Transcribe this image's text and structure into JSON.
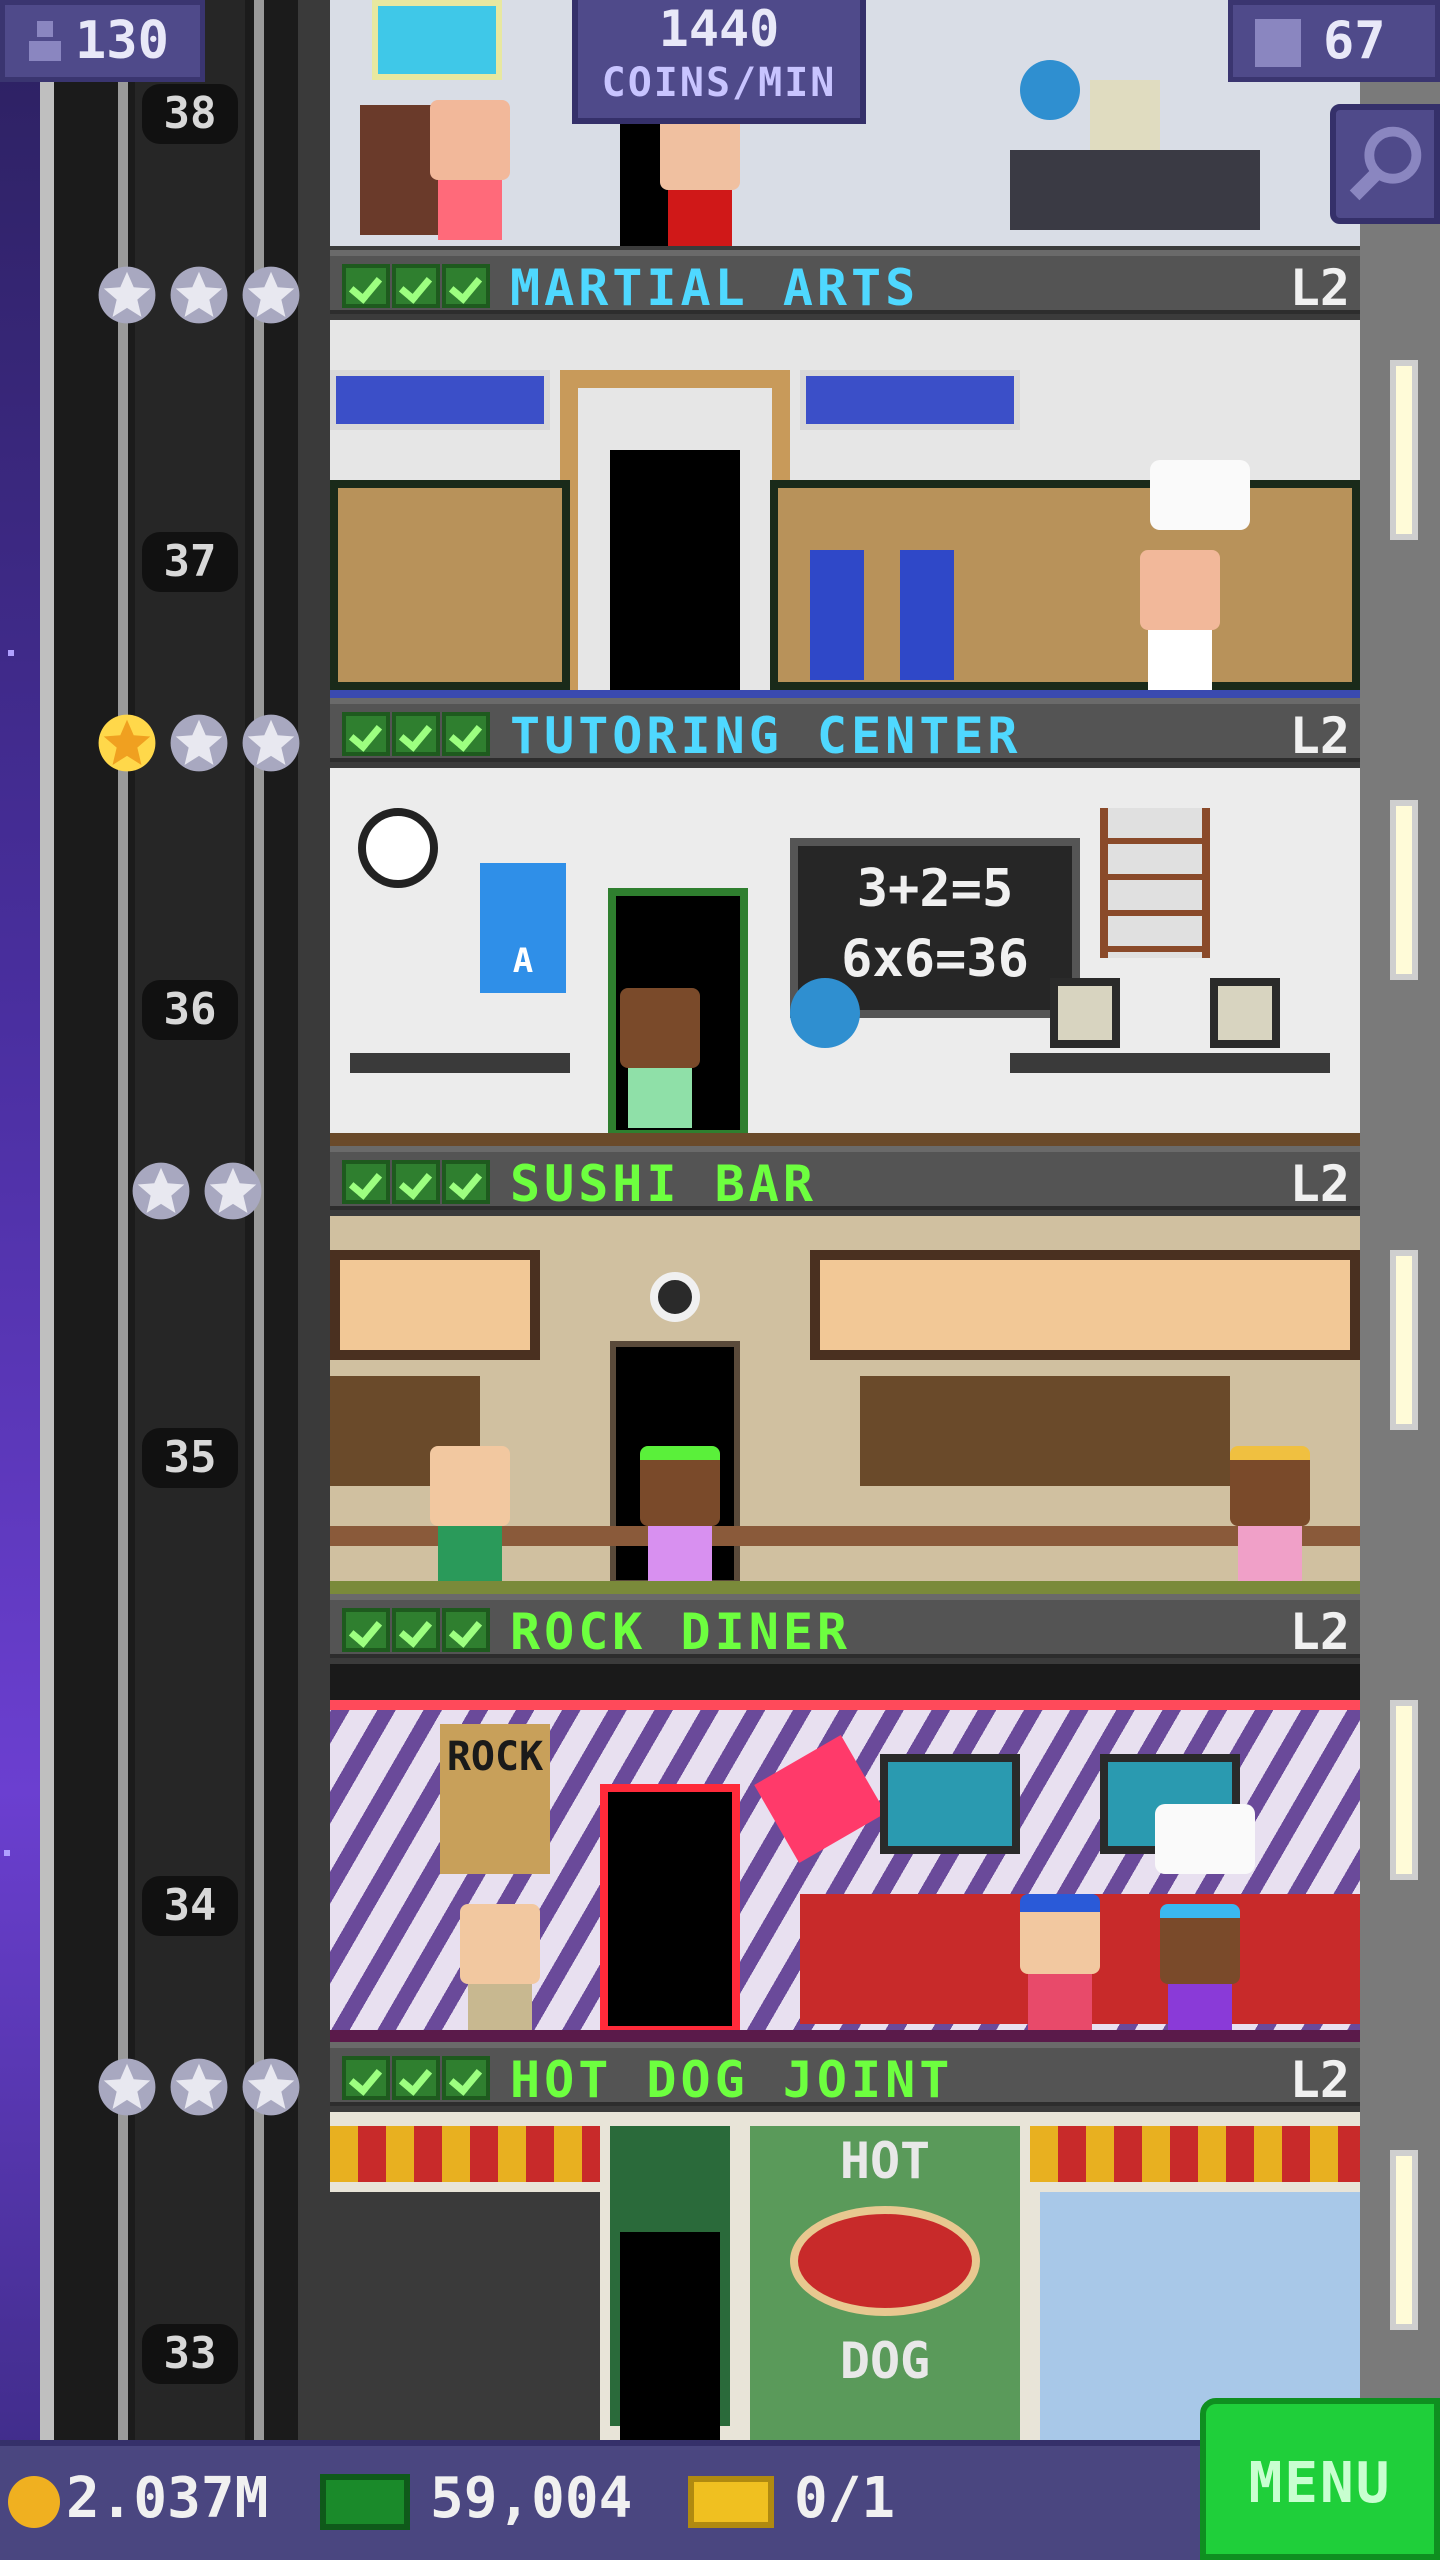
{
  "hud": {
    "population": "130",
    "coins_per_min_value": "1440",
    "coins_per_min_unit": "COINS/MIN",
    "floor_count": "67"
  },
  "elevator": {
    "floor_numbers": [
      "38",
      "37",
      "36",
      "35",
      "34",
      "33"
    ]
  },
  "floors": [
    {
      "name": "MARTIAL ARTS",
      "level": "L2",
      "name_color": "#4fd8ff",
      "stars_gold": 0,
      "stars_total": 3
    },
    {
      "name": "TUTORING CENTER",
      "level": "L2",
      "name_color": "#4fd8ff",
      "stars_gold": 1,
      "stars_total": 3
    },
    {
      "name": "SUSHI BAR",
      "level": "L2",
      "name_color": "#6dff3f",
      "stars_gold": 0,
      "stars_total": 2
    },
    {
      "name": "ROCK DINER",
      "level": "L2",
      "name_color": "#6dff3f",
      "stars_gold": 0,
      "stars_total": 0
    },
    {
      "name": "HOT DOG JOINT",
      "level": "L2",
      "name_color": "#6dff3f",
      "stars_gold": 0,
      "stars_total": 3
    }
  ],
  "room_text": {
    "chalkboard_line1": "3+2=5",
    "chalkboard_line2": "6x6=36",
    "poster_letter": "A",
    "rock_sign": "ROCK",
    "hotdog_sign_top": "HOT",
    "hotdog_sign_bottom": "DOG"
  },
  "footer": {
    "coins": "2.037M",
    "bux": "59,004",
    "tickets": "0/1",
    "menu_label": "MENU"
  },
  "colors": {
    "hud_panel": "#4f4a8a",
    "menu_green": "#1fcf3a",
    "check_green": "#9dff80"
  }
}
